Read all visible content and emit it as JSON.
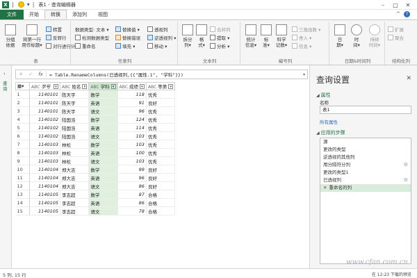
{
  "window": {
    "title": "表1 - 查询编辑器",
    "controls": [
      "–",
      "□",
      "✕"
    ]
  },
  "ribbon_tabs": [
    "文件",
    "开始",
    "转换",
    "添加列",
    "视图"
  ],
  "ribbon": {
    "table_group": {
      "label": "表",
      "btn_groupby": "分组\n依据",
      "btn_first_row_header": "将第一行\n用作标题▾",
      "btn_transpose": "转置",
      "btn_reverse_rows": "反转行",
      "btn_count_rows": "对行进行计数"
    },
    "any_column_group": {
      "label": "任意列",
      "btn_data_type": "数据类型: 文本 ▾",
      "btn_detect_type": "检测数据类型",
      "btn_rename": "重命名",
      "btn_replace_values": "替换值 ▾",
      "btn_replace_errors": "替换错误",
      "btn_fill": "填充 ▾",
      "btn_unpivot": "逆透视列 ▾",
      "btn_move": "移动 ▾",
      "btn_pivot": "透视列"
    },
    "text_column_group": {
      "label": "文本列",
      "btn_split": "拆分\n列▾",
      "btn_format": "格\n式▾",
      "btn_merge": "合并列",
      "btn_extract": "提取 ▾",
      "btn_parse": "分析 ▾"
    },
    "number_column_group": {
      "label": "编号列",
      "btn_statistics": "统计\n信息▾",
      "btn_standard": "标\n准▾",
      "btn_scientific": "科学\n记数▾",
      "btn_trig": "三角函数 ▾",
      "btn_rounding": "舍入 ▾",
      "btn_info": "信息 ▾"
    },
    "datetime_group": {
      "label": "日期&时间列",
      "btn_date": "日\n期▾",
      "btn_time": "时\n间▾",
      "btn_duration": "持续\n时间▾"
    },
    "structured_group": {
      "label": "结构化列",
      "btn_expand": "扩展",
      "btn_aggregate": "聚合"
    }
  },
  "rail": {
    "label": "查询"
  },
  "formula_bar": {
    "cancel": "✕",
    "confirm": "✓",
    "fx": "fx",
    "formula": "= Table.RenameColumns(已透视列,{{\"属性.1\", \"学科\"}})",
    "expand": "▾"
  },
  "grid": {
    "columns": [
      {
        "label": "学号",
        "type_icon": "ABC"
      },
      {
        "label": "姓名",
        "type_icon": "ABC"
      },
      {
        "label": "学科",
        "type_icon": "ABC"
      },
      {
        "label": "成绩",
        "type_icon": "ABC"
      },
      {
        "label": "等第",
        "type_icon": "ABC"
      }
    ],
    "rows": [
      [
        "1",
        "1140101",
        "陈天宇",
        "数学",
        "118",
        "优秀"
      ],
      [
        "2",
        "1140101",
        "陈天宇",
        "英语",
        "91",
        "良好"
      ],
      [
        "3",
        "1140101",
        "陈天宇",
        "语文",
        "96",
        "优秀"
      ],
      [
        "4",
        "1140102",
        "陆国浩",
        "数学",
        "124",
        "优秀"
      ],
      [
        "5",
        "1140102",
        "陆国浩",
        "英语",
        "114",
        "优秀"
      ],
      [
        "6",
        "1140102",
        "陆国浩",
        "语文",
        "103",
        "优秀"
      ],
      [
        "7",
        "1140103",
        "林松",
        "数学",
        "103",
        "优秀"
      ],
      [
        "8",
        "1140103",
        "林松",
        "英语",
        "100",
        "优秀"
      ],
      [
        "9",
        "1140103",
        "林松",
        "语文",
        "103",
        "优秀"
      ],
      [
        "10",
        "1140104",
        "郑大吉",
        "数学",
        "99",
        "良好"
      ],
      [
        "11",
        "1140104",
        "郑大吉",
        "英语",
        "96",
        "良好"
      ],
      [
        "12",
        "1140104",
        "郑大吉",
        "语文",
        "86",
        "良好"
      ],
      [
        "13",
        "1140105",
        "李志超",
        "数学",
        "87",
        "合格"
      ],
      [
        "14",
        "1140105",
        "李志超",
        "英语",
        "86",
        "合格"
      ],
      [
        "15",
        "1140105",
        "李志超",
        "语文",
        "78",
        "合格"
      ]
    ]
  },
  "query_settings": {
    "title": "查询设置",
    "close": "✕",
    "properties_header": "属性",
    "name_label": "名称",
    "name_value": "表1",
    "all_properties": "所有属性",
    "steps_header": "应用的步骤",
    "steps": [
      {
        "label": "源",
        "gear": false,
        "selected": false
      },
      {
        "label": "更改的类型",
        "gear": false,
        "selected": false
      },
      {
        "label": "逆透视的其他列",
        "gear": false,
        "selected": false
      },
      {
        "label": "用分隔符分列",
        "gear": true,
        "selected": false
      },
      {
        "label": "更改的类型1",
        "gear": false,
        "selected": false
      },
      {
        "label": "已透视列",
        "gear": true,
        "selected": false
      },
      {
        "label": "重命名的列",
        "gear": false,
        "selected": true
      }
    ]
  },
  "status": {
    "left": "5 列, 15 行",
    "right": "在 12:23 下载的预览"
  },
  "watermark": "www.cfan.com.cn"
}
